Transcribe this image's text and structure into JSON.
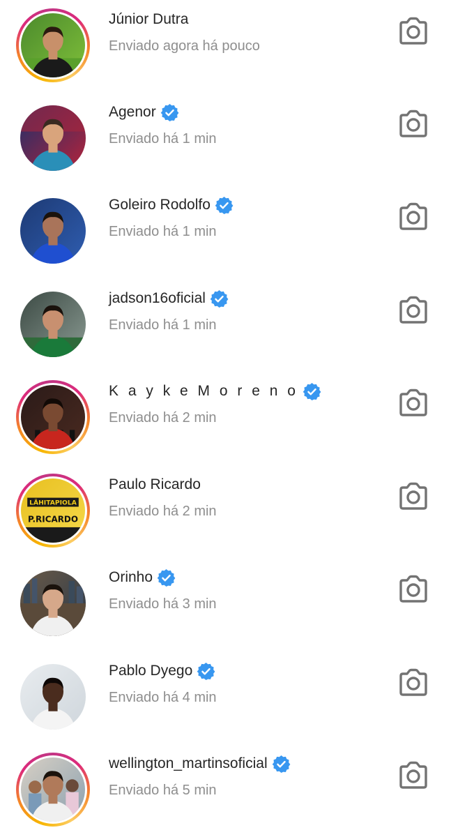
{
  "colors": {
    "name_text": "#262626",
    "subtitle_text": "#8e8e8e",
    "verified_badge": "#3897f0",
    "camera_icon": "#737373"
  },
  "contacts": [
    {
      "name": "Júnior Dutra",
      "status": "Enviado agora há pouco",
      "verified": false,
      "story_ring": true,
      "avatar": "player-photo-avatar",
      "camera_icon": "camera-icon"
    },
    {
      "name": "Agenor",
      "status": "Enviado há 1 min",
      "verified": true,
      "story_ring": false,
      "avatar": "goalkeeper-photo-avatar",
      "camera_icon": "camera-icon"
    },
    {
      "name": "Goleiro Rodolfo",
      "status": "Enviado há 1 min",
      "verified": true,
      "story_ring": false,
      "avatar": "goalkeeper-photo-avatar",
      "camera_icon": "camera-icon"
    },
    {
      "name": "jadson16oficial",
      "status": "Enviado há 1 min",
      "verified": true,
      "story_ring": false,
      "avatar": "player-field-photo-avatar",
      "camera_icon": "camera-icon"
    },
    {
      "name": "K a y k e  M o r e n o",
      "status": "Enviado há 2 min",
      "verified": true,
      "story_ring": true,
      "avatar": "player-photo-avatar",
      "camera_icon": "camera-icon"
    },
    {
      "name": "Paulo Ricardo",
      "status": "Enviado há 2 min",
      "verified": false,
      "story_ring": true,
      "avatar": "jersey-photo-avatar",
      "camera_icon": "camera-icon"
    },
    {
      "name": "Orinho",
      "status": "Enviado há 3 min",
      "verified": true,
      "story_ring": false,
      "avatar": "couple-photo-avatar",
      "camera_icon": "camera-icon"
    },
    {
      "name": "Pablo Dyego",
      "status": "Enviado há 4 min",
      "verified": true,
      "story_ring": false,
      "avatar": "portrait-photo-avatar",
      "camera_icon": "camera-icon"
    },
    {
      "name": "wellington_martinsoficial",
      "status": "Enviado há 5 min",
      "verified": true,
      "story_ring": true,
      "avatar": "family-photo-avatar",
      "camera_icon": "camera-icon"
    }
  ]
}
